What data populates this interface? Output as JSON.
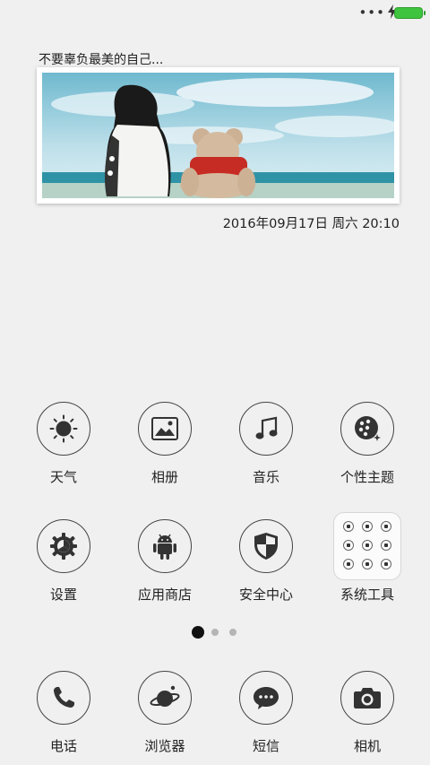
{
  "status_bar": {
    "more_indicator": "•••",
    "charging_icon": "bolt-icon",
    "battery_color": "#3fc43f"
  },
  "widget": {
    "title": "不要辜负最美的自己...",
    "datetime": "2016年09月17日 周六 20:10"
  },
  "apps_row1": [
    {
      "label": "天气",
      "icon": "sun-icon"
    },
    {
      "label": "相册",
      "icon": "picture-icon"
    },
    {
      "label": "音乐",
      "icon": "music-note-icon"
    },
    {
      "label": "个性主题",
      "icon": "palette-icon"
    }
  ],
  "apps_row2": [
    {
      "label": "设置",
      "icon": "gear-icon"
    },
    {
      "label": "应用商店",
      "icon": "android-icon"
    },
    {
      "label": "安全中心",
      "icon": "shield-icon"
    },
    {
      "label": "系统工具",
      "icon": "folder-icon"
    }
  ],
  "pager": {
    "pages": 3,
    "current": 1
  },
  "dock": [
    {
      "label": "电话",
      "icon": "phone-icon"
    },
    {
      "label": "浏览器",
      "icon": "planet-icon"
    },
    {
      "label": "短信",
      "icon": "message-icon"
    },
    {
      "label": "相机",
      "icon": "camera-icon"
    }
  ]
}
